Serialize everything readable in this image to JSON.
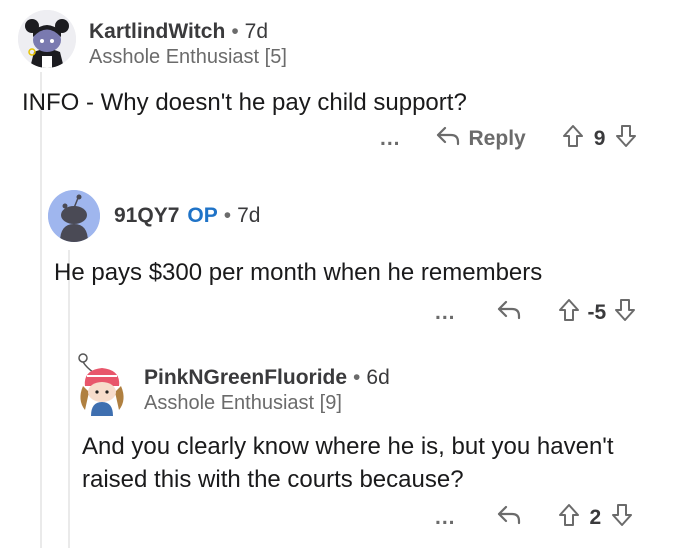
{
  "comments": [
    {
      "username": "KartlindWitch",
      "age": "7d",
      "flair": "Asshole Enthusiast [5]",
      "body": "INFO - Why doesn't he pay child support?",
      "reply_label": "Reply",
      "score": "9",
      "more": "..."
    },
    {
      "username": "91QY7",
      "op_badge": "OP",
      "age": "7d",
      "body": "He pays $300 per month when he remembers",
      "score": "-5",
      "more": "..."
    },
    {
      "username": "PinkNGreenFluoride",
      "age": "6d",
      "flair": "Asshole Enthusiast [9]",
      "body_line1": "And you clearly know where he is, but you haven't",
      "body_line2": "raised this with the courts because?",
      "score": "2",
      "more": "..."
    }
  ],
  "separator": "•",
  "icons": {
    "reply": "reply-arrow-icon",
    "upvote": "upvote-arrow-icon",
    "downvote": "downvote-arrow-icon",
    "more": "more-options-icon"
  },
  "colors": {
    "op_badge": "#1f73c7",
    "text": "#1a1a1b",
    "muted": "#6b6b6b",
    "thread_line": "#eaeaea",
    "avatar_bg_op": "#9fb6ee"
  }
}
